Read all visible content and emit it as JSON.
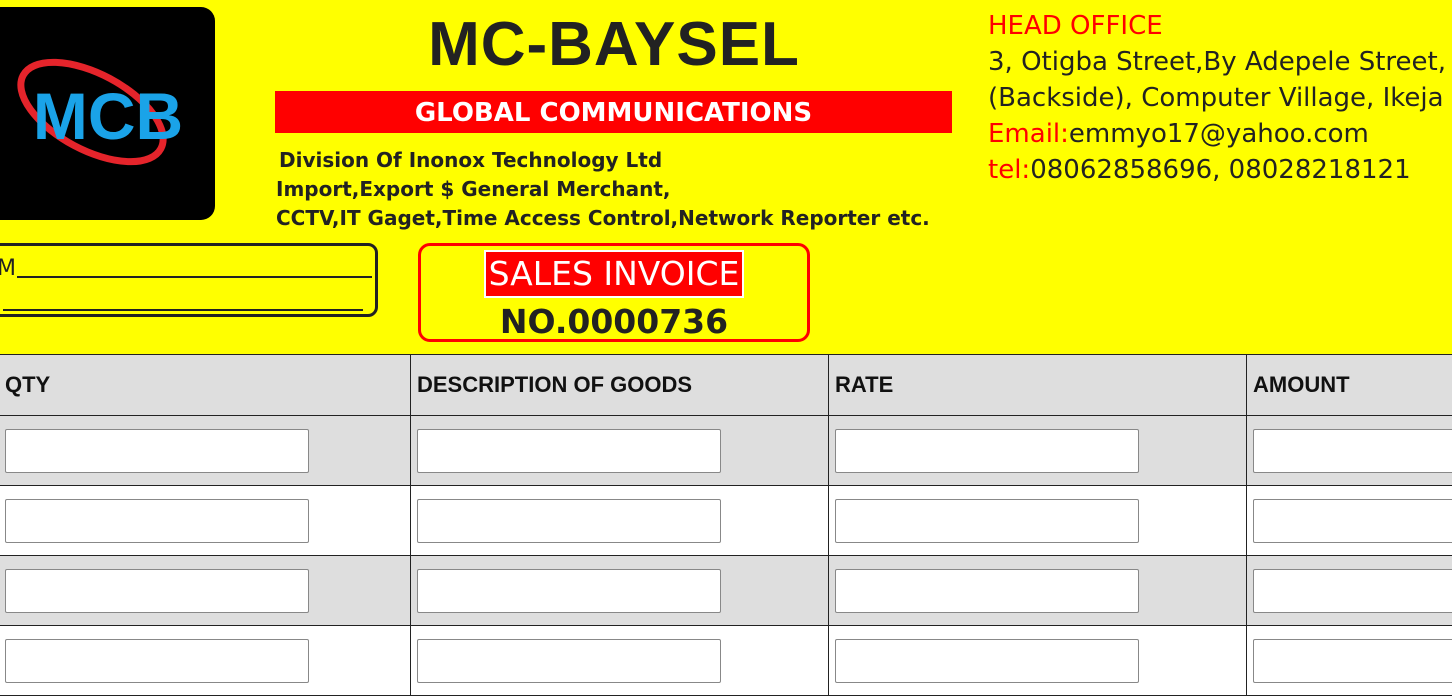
{
  "logo": {
    "text": "MCB"
  },
  "brand": {
    "title": "MC-BAYSEL",
    "band": "GLOBAL COMMUNICATIONS",
    "lines": [
      "Division Of Inonox Technology Ltd",
      "Import,Export $ General Merchant,",
      "CCTV,IT Gaget,Time Access Control,Network Reporter etc."
    ]
  },
  "office": {
    "heading": "HEAD OFFICE",
    "address1": "3, Otigba Street,By Adepele Street,",
    "address2": "(Backside), Computer Village, Ikeja",
    "email_label": "Email:",
    "email_value": "emmyo17@yahoo.com",
    "tel_label": "tel:",
    "tel_value": "08062858696, 08028218121"
  },
  "customer": {
    "label": "M"
  },
  "invoice": {
    "title": "SALES INVOICE",
    "number": "NO.0000736"
  },
  "table": {
    "headers": [
      "QTY",
      "DESCRIPTION OF GOODS",
      "RATE",
      "AMOUNT"
    ],
    "rows": [
      {
        "qty": "",
        "description": "",
        "rate": "",
        "amount": ""
      },
      {
        "qty": "",
        "description": "",
        "rate": "",
        "amount": ""
      },
      {
        "qty": "",
        "description": "",
        "rate": "",
        "amount": ""
      },
      {
        "qty": "",
        "description": "",
        "rate": "",
        "amount": ""
      }
    ]
  },
  "colors": {
    "background": "#ffff00",
    "accent": "#ff0000",
    "logo_blue": "#1aa3e8"
  }
}
